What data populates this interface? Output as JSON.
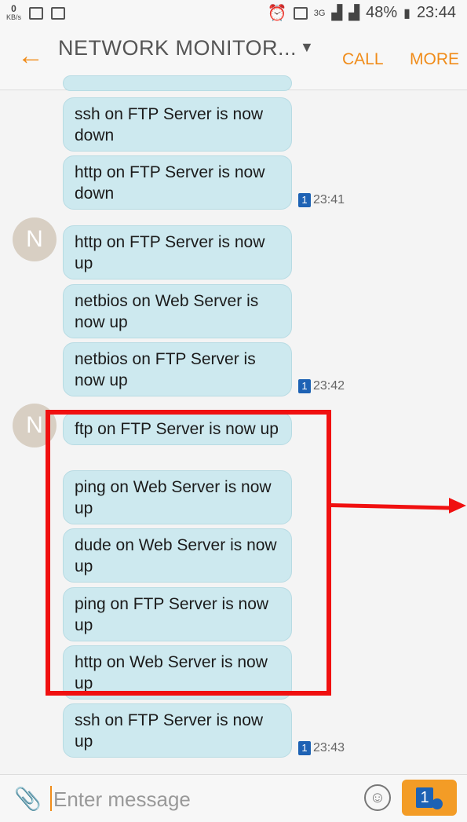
{
  "status": {
    "speed_value": "0",
    "speed_unit": "KB/s",
    "network": "3G",
    "battery": "48%",
    "time": "23:44"
  },
  "header": {
    "back_icon": "back-arrow-icon",
    "title": "NETWORK MONITOR...",
    "call_label": "CALL",
    "more_label": "MORE"
  },
  "avatar_letter": "N",
  "messages": [
    {
      "text": "ssh on FTP Server is now down"
    },
    {
      "text": "http on FTP Server is now down"
    },
    {
      "text": "http on FTP Server is now up"
    },
    {
      "text": "netbios on Web Server is now up"
    },
    {
      "text": "netbios on FTP Server is now up"
    },
    {
      "text": "ftp on FTP Server is now up"
    },
    {
      "text": "ping on Web Server is now up"
    },
    {
      "text": "dude on Web Server is now up"
    },
    {
      "text": "ping on FTP Server is now up"
    },
    {
      "text": "http on Web Server is now up"
    },
    {
      "text": "ssh on FTP Server is now up"
    }
  ],
  "timestamps": [
    {
      "sim": "1",
      "time": "23:41"
    },
    {
      "sim": "1",
      "time": "23:42"
    },
    {
      "sim": "1",
      "time": "23:43"
    }
  ],
  "composer": {
    "placeholder": "Enter message",
    "send_sim": "1"
  },
  "colors": {
    "accent": "#f08c1a",
    "bubble": "#cde9ef",
    "highlight": "#f01010",
    "sim_badge": "#1d62b4"
  }
}
